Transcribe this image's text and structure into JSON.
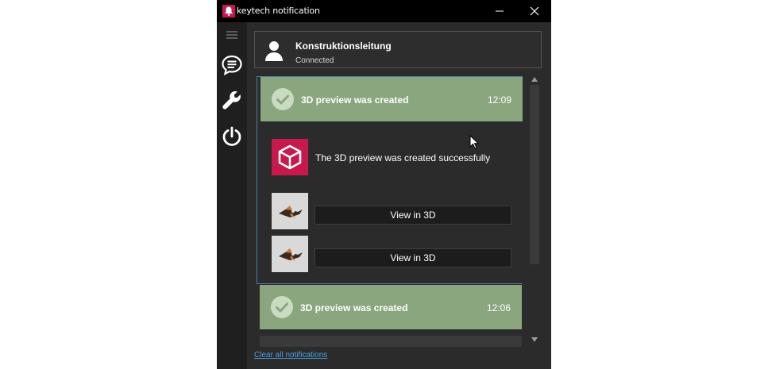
{
  "window": {
    "title": "keytech notification",
    "accent": "#c8194d"
  },
  "sidebar": {
    "items": [
      {
        "icon": "hamburger-icon"
      },
      {
        "icon": "chat-icon"
      },
      {
        "icon": "wrench-icon"
      },
      {
        "icon": "power-icon"
      }
    ]
  },
  "header": {
    "name": "Konstruktionsleitung",
    "status": "Connected"
  },
  "notifications": [
    {
      "title": "3D preview was created",
      "time": "12:09",
      "message": "The 3D preview was created successfully",
      "attachments": [
        {
          "button_label": "View in 3D"
        },
        {
          "button_label": "View in 3D"
        }
      ]
    },
    {
      "title": "3D preview was created",
      "time": "12:06"
    }
  ],
  "footer": {
    "clear_label": "Clear all notifications"
  },
  "colors": {
    "success_header": "#8aa67f",
    "link": "#4a9fe0",
    "selection_border": "#4d7fa5"
  }
}
